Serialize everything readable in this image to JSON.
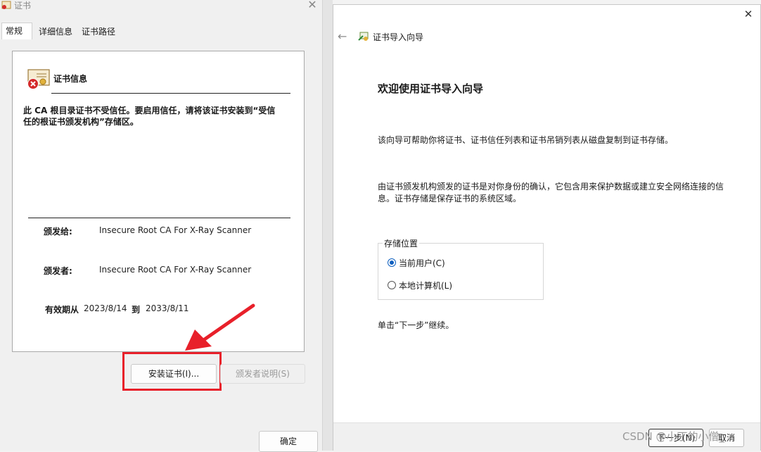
{
  "cert_dialog": {
    "title": "证书",
    "tabs": [
      "常规",
      "详细信息",
      "证书路径"
    ],
    "info_heading": "证书信息",
    "warning_line1": "此 CA 根目录证书不受信任。要启用信任，请将该证书安装到“受信",
    "warning_line2": "任的根证书颁发机构”存储区。",
    "issued_to_label": "颁发给:",
    "issued_to_value": "Insecure Root CA For X-Ray Scanner",
    "issued_by_label": "颁发者:",
    "issued_by_value": "Insecure Root CA For X-Ray Scanner",
    "valid_label": "有效期从",
    "valid_from": "2023/8/14",
    "valid_to_label": "到",
    "valid_to": "2033/8/11",
    "install_button": "安装证书(I)...",
    "issuer_statement_button": "颁发者说明(S)",
    "ok_button": "确定",
    "highlight_color": "#e8202a"
  },
  "wizard": {
    "title": "证书导入向导",
    "heading": "欢迎使用证书导入向导",
    "para1": "该向导可帮助你将证书、证书信任列表和证书吊销列表从磁盘复制到证书存储。",
    "para2_line1": "由证书颁发机构颁发的证书是对你身份的确认，它包含用来保护数据或建立安全网络连接的信",
    "para2_line2": "息。证书存储是保存证书的系统区域。",
    "store_location_label": "存储位置",
    "option_current_user": "当前用户(C)",
    "option_local_machine": "本地计算机(L)",
    "selected_option": "当前用户(C)",
    "continue_hint": "单击“下一步”继续。",
    "next_button": "下一步(N)",
    "cancel_button": "取消",
    "accent_color": "#0e5fbf"
  },
  "watermark": "CSDN @小丁的小僧_"
}
